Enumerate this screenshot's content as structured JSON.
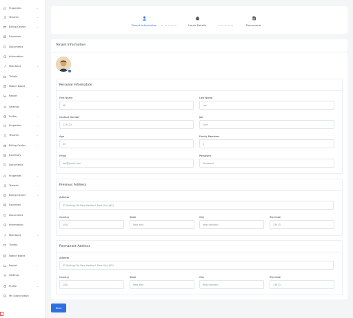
{
  "sidebar": {
    "items": [
      {
        "icon": "home-icon",
        "label": "Properties",
        "chevron": true
      },
      {
        "icon": "user-icon",
        "label": "Tenants",
        "chevron": true
      },
      {
        "icon": "billing-icon",
        "label": "Billing Center",
        "chevron": true
      },
      {
        "icon": "expense-icon",
        "label": "Expenses",
        "chevron": false
      },
      {
        "icon": "document-icon",
        "label": "Documents",
        "chevron": false
      },
      {
        "icon": "info-icon",
        "label": "Information",
        "chevron": false
      },
      {
        "icon": "maintainer-icon",
        "label": "Maintains",
        "chevron": true
      },
      {
        "icon": "ticket-icon",
        "label": "Tickets",
        "chevron": false
      },
      {
        "icon": "notice-icon",
        "label": "Notice Board",
        "chevron": false
      },
      {
        "icon": "report-icon",
        "label": "Report",
        "chevron": true
      },
      {
        "icon": "settings-icon",
        "label": "Settings",
        "chevron": false
      },
      {
        "icon": "profile-icon",
        "label": "Profile",
        "chevron": true
      },
      {
        "icon": "home-icon",
        "label": "Properties",
        "chevron": true
      },
      {
        "icon": "user-icon",
        "label": "Tenants",
        "chevron": true
      },
      {
        "icon": "billing-icon",
        "label": "Billing Center",
        "chevron": true
      },
      {
        "icon": "expense-icon",
        "label": "Expenses",
        "chevron": false
      },
      {
        "icon": "document-icon",
        "label": "Documents",
        "chevron": false
      },
      {
        "icon": "home-icon",
        "label": "Properties",
        "chevron": true
      },
      {
        "icon": "user-icon",
        "label": "Tenants",
        "chevron": true
      },
      {
        "icon": "billing-icon",
        "label": "Billing Center",
        "chevron": true
      },
      {
        "icon": "expense-icon",
        "label": "Expenses",
        "chevron": false
      },
      {
        "icon": "document-icon",
        "label": "Documents",
        "chevron": false
      },
      {
        "icon": "info-icon",
        "label": "Information",
        "chevron": false
      },
      {
        "icon": "maintainer-icon",
        "label": "Maintains",
        "chevron": true
      },
      {
        "icon": "ticket-icon",
        "label": "Tickets",
        "chevron": false
      },
      {
        "icon": "notice-icon",
        "label": "Notice Board",
        "chevron": false
      },
      {
        "icon": "report-icon",
        "label": "Report",
        "chevron": true
      },
      {
        "icon": "settings-icon",
        "label": "Settings",
        "chevron": false
      },
      {
        "icon": "profile-icon",
        "label": "Profile",
        "chevron": true
      },
      {
        "icon": "subscription-icon",
        "label": "My Subscription",
        "chevron": false
      }
    ]
  },
  "steps": [
    {
      "label": "Tenant Information",
      "active": true,
      "icon": "user-icon"
    },
    {
      "label": "Home Details",
      "active": false,
      "icon": "home-icon"
    },
    {
      "label": "Documents",
      "active": false,
      "icon": "document-icon"
    }
  ],
  "info": {
    "title": "Tenant Information"
  },
  "personal": {
    "title": "Personal Information",
    "first_name_label": "First Name",
    "first_name_value": "Mr",
    "last_name_label": "Last Name",
    "last_name_value": "Leo",
    "contact_label": "Contact Number",
    "contact_value": "123123",
    "job_label": "Job",
    "job_value": "Chef",
    "age_label": "Age",
    "age_value": "35",
    "family_label": "Family Members",
    "family_value": "2",
    "email_label": "Email",
    "email_value": "leo@gmail.com",
    "password_label": "Password",
    "password_value": "Password"
  },
  "previous": {
    "title": "Previous Address",
    "address_label": "Address",
    "address_value": "32 Rollings Rd New Hartford, New York (NY)",
    "country_label": "Country",
    "country_value": "USA",
    "state_label": "State",
    "state_value": "New York",
    "city_label": "City",
    "city_value": "New Hartford",
    "zip_label": "Zip Code",
    "zip_value": "13413"
  },
  "permanent": {
    "title": "Permanent Address",
    "address_label": "Address",
    "address_value": "32 Rollings Rd New Hartford, New York (NY)",
    "country_label": "Country",
    "country_value": "USA",
    "state_label": "State",
    "state_value": "New York",
    "city_label": "City",
    "city_value": "New Hartford",
    "zip_label": "Zip Code",
    "zip_value": "13413"
  },
  "next_label": "Next",
  "colors": {
    "accent": "#2d6fe0",
    "background": "#f4f5f7"
  }
}
